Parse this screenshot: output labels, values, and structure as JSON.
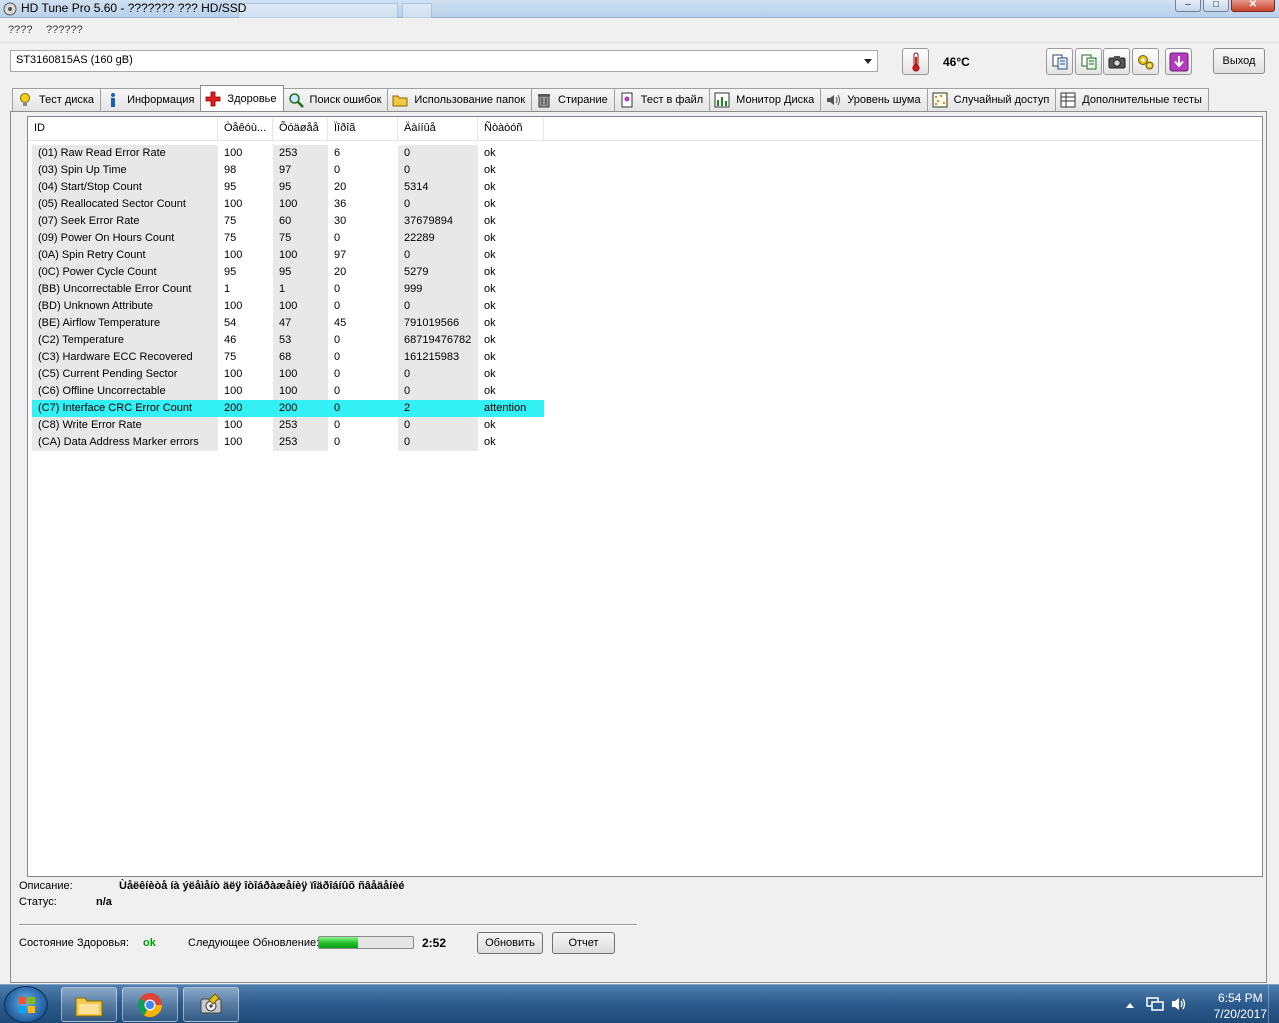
{
  "window": {
    "title": "HD Tune Pro 5.60 - ??????? ??? HD/SSD",
    "minimize_glyph": "–",
    "maximize_glyph": "□",
    "close_glyph": "✕"
  },
  "menu": {
    "items": [
      {
        "label": "????"
      },
      {
        "label": "??????"
      }
    ]
  },
  "drive": {
    "selected": "ST3160815AS (160 gB)",
    "temperature": "46°C",
    "exit_label": "Выход"
  },
  "toolbar_icons": [
    "thermometer-icon",
    "copy-info-icon",
    "copy-all-icon",
    "screenshot-icon",
    "options-icon",
    "save-icon"
  ],
  "tabs": [
    {
      "label": "Тест диска",
      "icon": "benchmark-icon"
    },
    {
      "label": "Информация",
      "icon": "info-icon"
    },
    {
      "label": "Здоровье",
      "icon": "health-icon",
      "active": true
    },
    {
      "label": "Поиск ошибок",
      "icon": "error-scan-icon"
    },
    {
      "label": "Использование папок",
      "icon": "folder-usage-icon"
    },
    {
      "label": "Стирание",
      "icon": "erase-icon"
    },
    {
      "label": "Тест в файл",
      "icon": "file-benchmark-icon"
    },
    {
      "label": "Монитор Диска",
      "icon": "disk-monitor-icon"
    },
    {
      "label": "Уровень шума",
      "icon": "noise-level-icon"
    },
    {
      "label": "Случайный доступ",
      "icon": "random-access-icon"
    },
    {
      "label": "Дополнительные  тесты",
      "icon": "extra-tests-icon"
    }
  ],
  "smart": {
    "columns": [
      "ID",
      "Òåêóù...",
      "Õóäøåå",
      "Ïîðîã",
      "Äàííûå",
      "Ñòàòóñ"
    ],
    "rows": [
      [
        "(01) Raw Read Error Rate",
        "100",
        "253",
        "6",
        "0",
        "ok"
      ],
      [
        "(03) Spin Up Time",
        "98",
        "97",
        "0",
        "0",
        "ok"
      ],
      [
        "(04) Start/Stop Count",
        "95",
        "95",
        "20",
        "5314",
        "ok"
      ],
      [
        "(05) Reallocated Sector Count",
        "100",
        "100",
        "36",
        "0",
        "ok"
      ],
      [
        "(07) Seek Error Rate",
        "75",
        "60",
        "30",
        "37679894",
        "ok"
      ],
      [
        "(09) Power On Hours Count",
        "75",
        "75",
        "0",
        "22289",
        "ok"
      ],
      [
        "(0A) Spin Retry Count",
        "100",
        "100",
        "97",
        "0",
        "ok"
      ],
      [
        "(0C) Power Cycle Count",
        "95",
        "95",
        "20",
        "5279",
        "ok"
      ],
      [
        "(BB) Uncorrectable Error Count",
        "1",
        "1",
        "0",
        "999",
        "ok"
      ],
      [
        "(BD) Unknown Attribute",
        "100",
        "100",
        "0",
        "0",
        "ok"
      ],
      [
        "(BE) Airflow Temperature",
        "54",
        "47",
        "45",
        "791019566",
        "ok"
      ],
      [
        "(C2) Temperature",
        "46",
        "53",
        "0",
        "68719476782",
        "ok"
      ],
      [
        "(C3) Hardware ECC Recovered",
        "75",
        "68",
        "0",
        "161215983",
        "ok"
      ],
      [
        "(C5) Current Pending Sector",
        "100",
        "100",
        "0",
        "0",
        "ok"
      ],
      [
        "(C6) Offline Uncorrectable",
        "100",
        "100",
        "0",
        "0",
        "ok"
      ],
      [
        "(C7) Interface CRC Error Count",
        "200",
        "200",
        "0",
        "2",
        "attention"
      ],
      [
        "(C8) Write Error Rate",
        "100",
        "253",
        "0",
        "0",
        "ok"
      ],
      [
        "(CA) Data Address Marker errors",
        "100",
        "253",
        "0",
        "0",
        "ok"
      ]
    ],
    "highlight_color": "#33f0f5"
  },
  "details": {
    "description_label": "Описание:",
    "description_value": "Ùåëêíèòå íà ýëåìåíò äëÿ îòîáðàæåíèÿ ïîäðîáíûõ ñâåäåíèé",
    "status_label": "Статус:",
    "status_value": "n/a"
  },
  "health": {
    "label": "Состояние Здоровья:",
    "value": "ok",
    "value_color": "#00a000",
    "next_update_label": "Следующее Обновление:",
    "next_update_progress": 0.42,
    "countdown": "2:52",
    "refresh_label": "Обновить",
    "report_label": "Отчет"
  },
  "taskbar": {
    "apps": [
      "explorer-icon",
      "chrome-icon",
      "hdtune-icon"
    ],
    "time": "6:54 PM",
    "date": "7/20/2017"
  }
}
